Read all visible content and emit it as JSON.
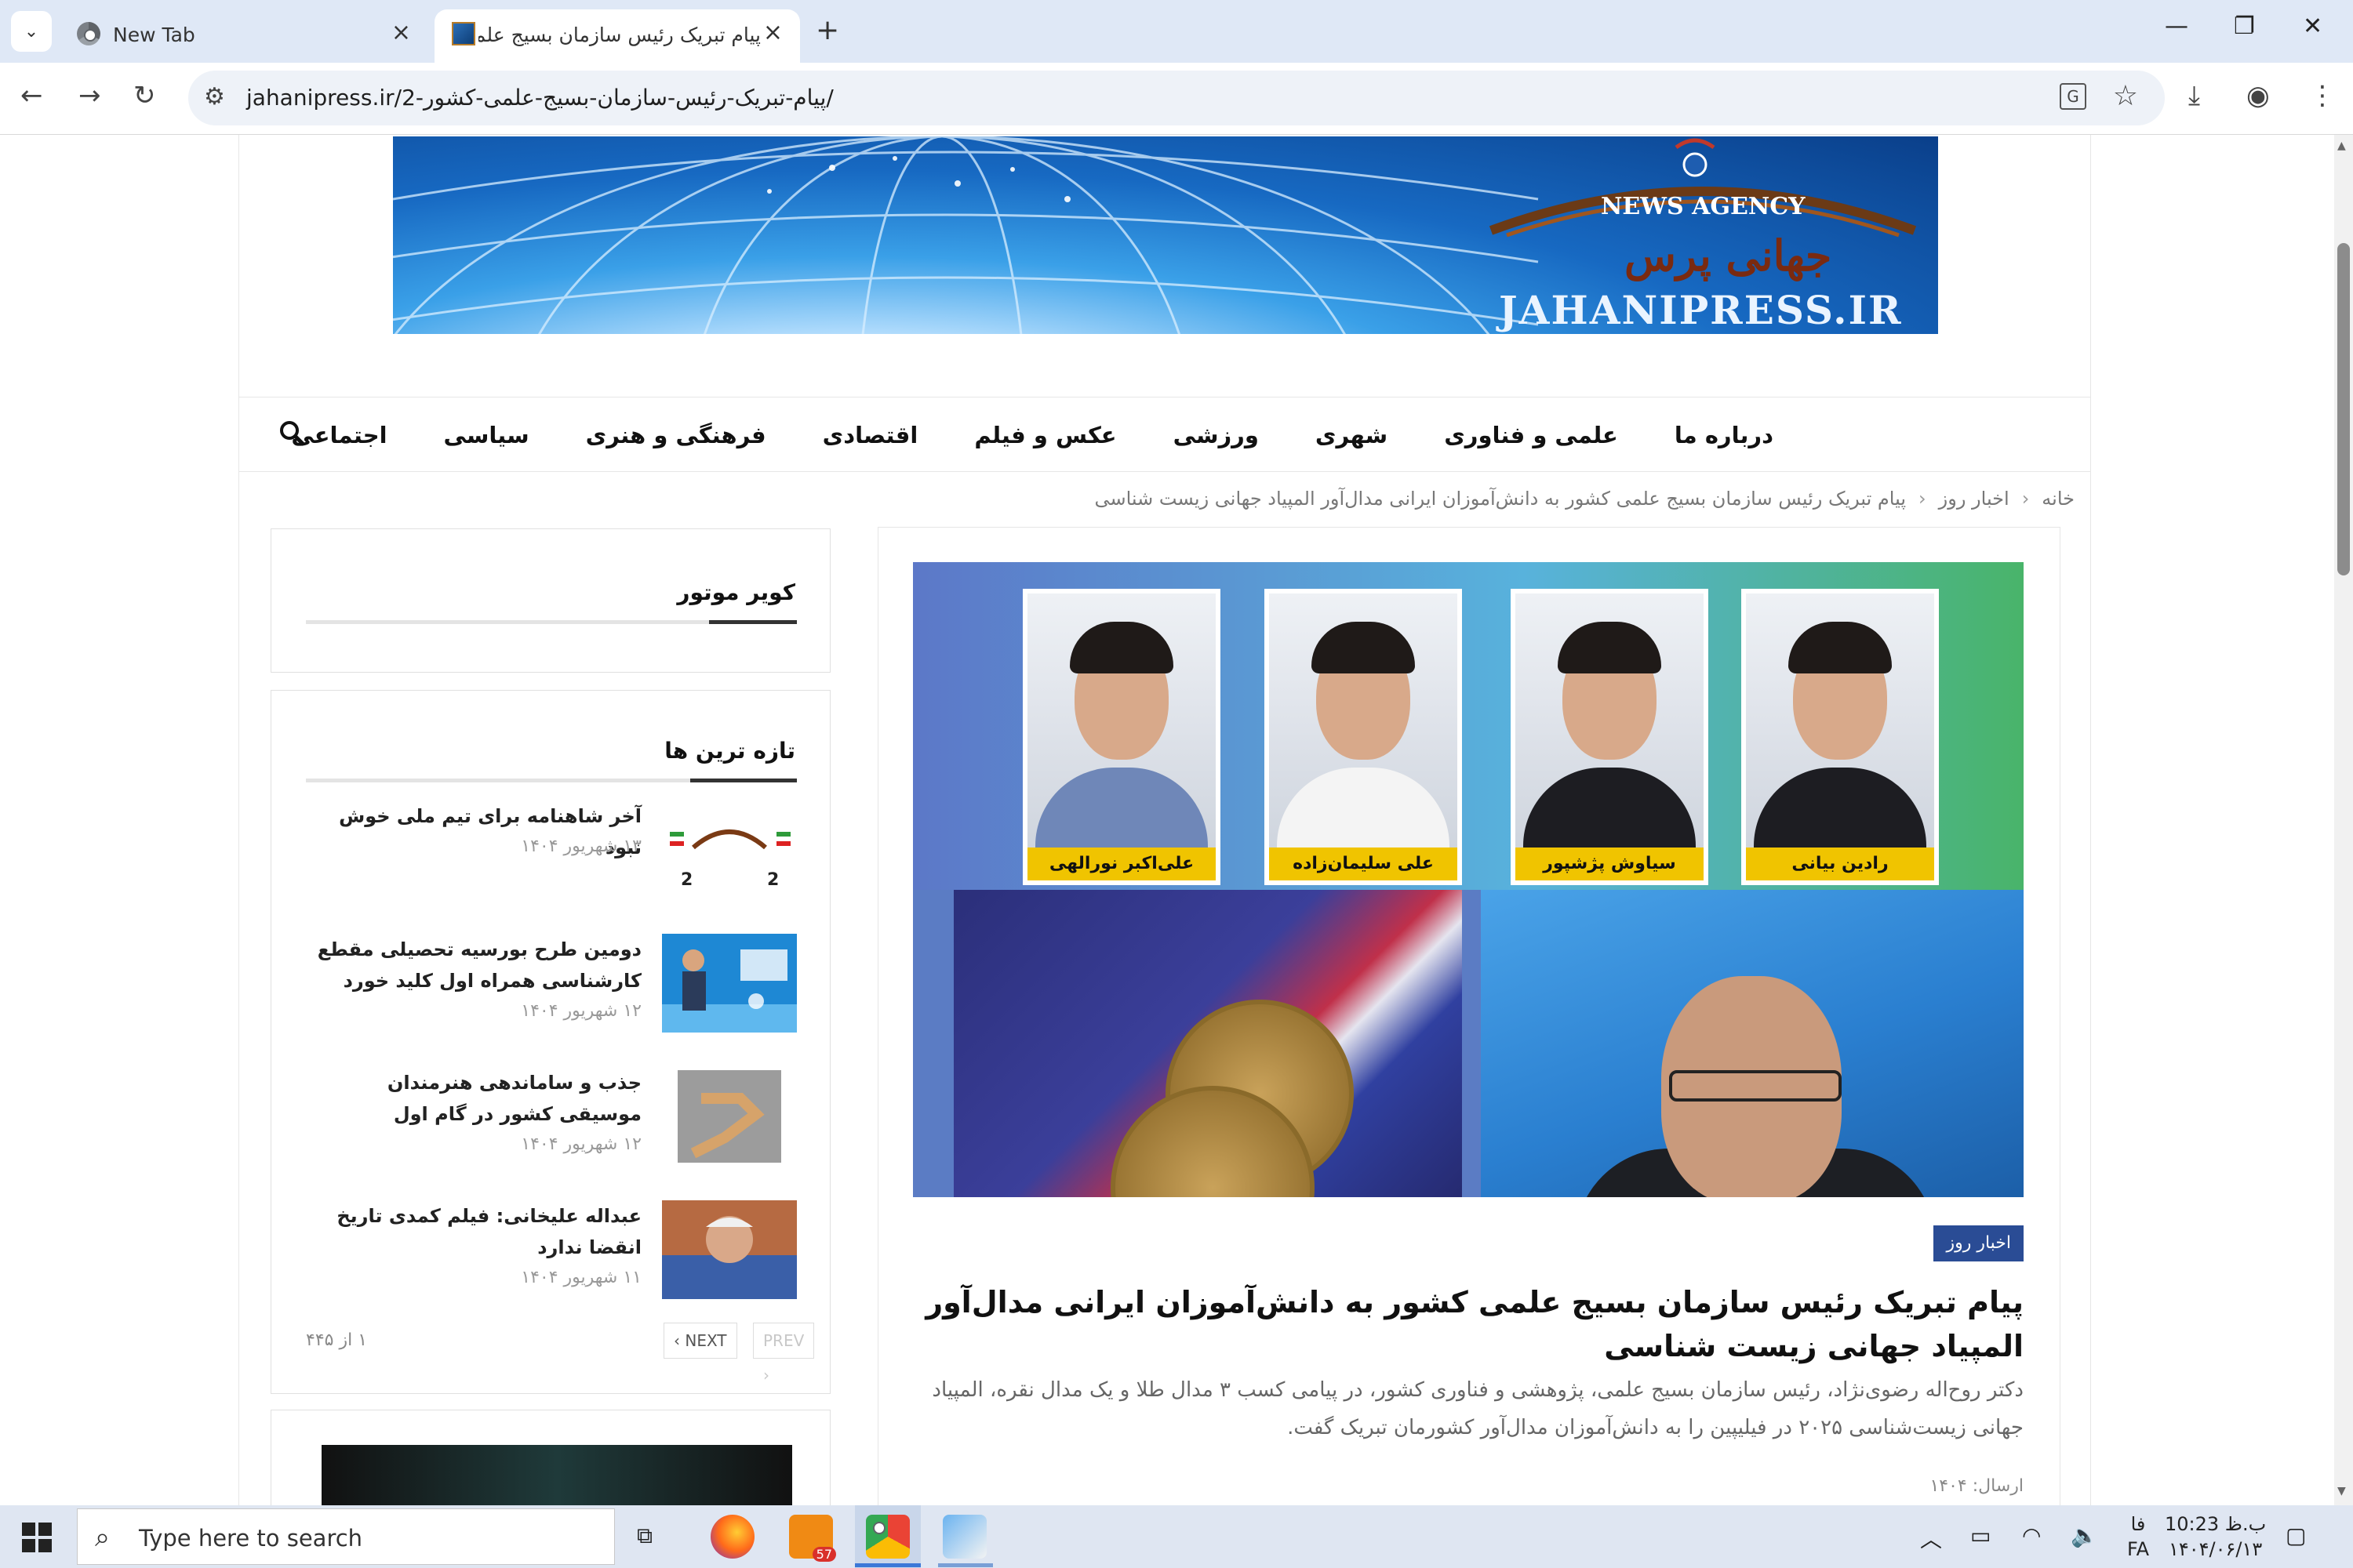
{
  "browser": {
    "tabs": [
      {
        "title": "New Tab",
        "active": false
      },
      {
        "title": "پیام تبریک رئیس سازمان بسیج علمی",
        "active": true
      }
    ],
    "url": "jahanipress.ir/2-پیام-تبریک-رئیس-سازمان-بسیج-علمی-کشور/"
  },
  "banner": {
    "news_agency": "NEWS AGENCY",
    "name_fa": "جهانی پرس",
    "domain": "JAHANIPRESS.IR"
  },
  "nav": {
    "items": [
      "اجتماعی",
      "سیاسی",
      "فرهنگی و هنری",
      "اقتصادی",
      "عکس و فیلم",
      "ورزشی",
      "شهری",
      "علمی و فناوری",
      "درباره ما"
    ]
  },
  "breadcrumb": {
    "home": "خانه",
    "category": "اخبار روز",
    "current": "پیام تبریک رئیس سازمان بسیج علمی کشور به دانش‌آموزان ایرانی مدال‌آور المپیاد جهانی زیست شناسی"
  },
  "article": {
    "image_names": [
      "رادین بیانی",
      "سیاوش پژشپور",
      "علی سلیمان‌زاده",
      "علی‌اکبر نورالهی"
    ],
    "category": "اخبار روز",
    "title": "پیام تبریک رئیس سازمان بسیج علمی کشور به دانش‌آموزان ایرانی مدال‌آور المپیاد جهانی زیست شناسی",
    "excerpt": "دکتر روح‌اله رضوی‌نژاد، رئیس سازمان بسیج علمی، پژوهشی و فناوری کشور، در پیامی کسب ۳ مدال طلا و یک مدال نقره، المپیاد جهانی زیست‌شناسی ۲۰۲۵ در فیلیپین را به دانش‌آموزان مدال‌آور کشورمان تبریک گفت.",
    "meta": "ارسال: ۱۴۰۴"
  },
  "sidebar": {
    "widget1_title": "کویر موتور",
    "widget2_title": "تازه ترین ها",
    "posts": [
      {
        "title": "آخر شاهنامه برای تیم ملی خوش نبود",
        "date": "۱۳ شهریور ۱۴۰۴"
      },
      {
        "title": "دومین طرح بورسیه تحصیلی مقطع کارشناسی همراه اول کلید خورد",
        "date": "۱۲ شهریور ۱۴۰۴"
      },
      {
        "title": "جذب و ساماندهی هنرمندان موسیقی کشور در گام اول",
        "date": "۱۲ شهریور ۱۴۰۴"
      },
      {
        "title": "عبداله علیخانی: فیلم کمدی تاریخ انقضا ندارد",
        "date": "۱۱ شهریور ۱۴۰۴"
      }
    ],
    "pager": {
      "count": "۱ از ۴۴۵",
      "next": "NEXT",
      "prev": "PREV"
    }
  },
  "taskbar": {
    "search_placeholder": "Type here to search",
    "badge": "57",
    "lang_top": "فا",
    "lang_bottom": "FA",
    "time": "10:23 ب.ظ",
    "date": "۱۴۰۴/۰۶/۱۳"
  },
  "colors": {
    "accent": "#2a4c95",
    "tabbar": "#dfe8f6",
    "taskbar": "#dfe6f2"
  }
}
